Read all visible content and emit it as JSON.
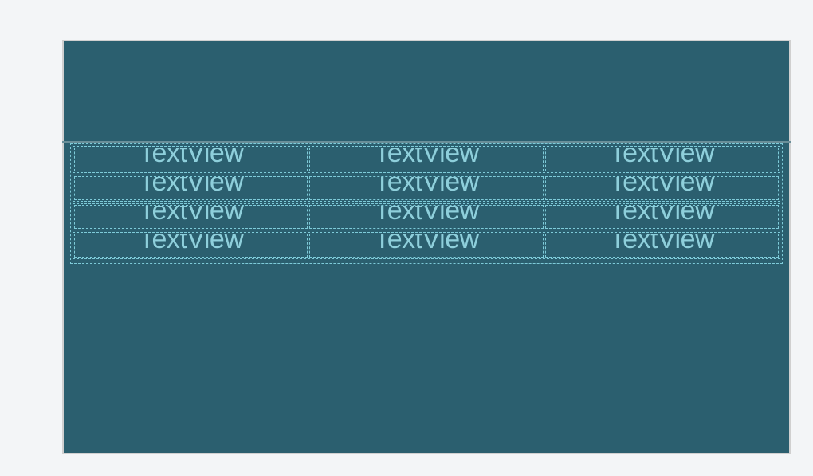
{
  "table": {
    "rows": [
      {
        "cells": [
          {
            "label": "TextView"
          },
          {
            "label": "TextView"
          },
          {
            "label": "TextView"
          }
        ]
      },
      {
        "cells": [
          {
            "label": "TextView"
          },
          {
            "label": "TextView"
          },
          {
            "label": "TextView"
          }
        ]
      },
      {
        "cells": [
          {
            "label": "TextView"
          },
          {
            "label": "TextView"
          },
          {
            "label": "TextView"
          }
        ]
      },
      {
        "cells": [
          {
            "label": "TextView"
          },
          {
            "label": "TextView"
          },
          {
            "label": "TextView"
          }
        ]
      }
    ]
  }
}
